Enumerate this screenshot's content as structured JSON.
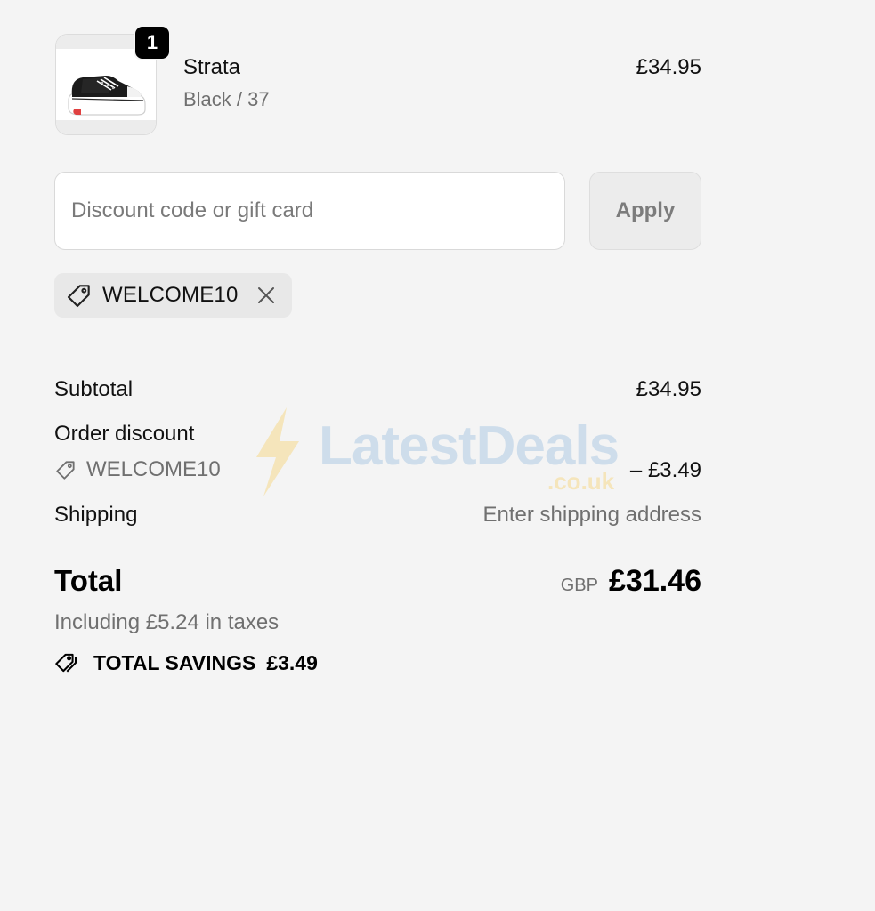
{
  "product": {
    "name": "Strata",
    "variant": "Black / 37",
    "price": "£34.95",
    "quantity": "1",
    "thumbnail_icon": "sneaker-icon"
  },
  "discount": {
    "placeholder": "Discount code or gift card",
    "value": "",
    "apply_label": "Apply",
    "applied_code": "WELCOME10"
  },
  "summary": {
    "subtotal_label": "Subtotal",
    "subtotal_value": "£34.95",
    "order_discount_label": "Order discount",
    "order_discount_code": "WELCOME10",
    "order_discount_value": "– £3.49",
    "shipping_label": "Shipping",
    "shipping_value": "Enter shipping address"
  },
  "total": {
    "label": "Total",
    "currency": "GBP",
    "amount": "£31.46",
    "taxes_note": "Including £5.24 in taxes",
    "savings_label": "TOTAL SAVINGS",
    "savings_value": "£3.49"
  },
  "watermark": {
    "brand": "LatestDeals",
    "domain": ".co.uk"
  },
  "colors": {
    "background": "#f4f4f4",
    "muted_text": "#707070",
    "chip_background": "#e8e8e8",
    "badge": "#000000"
  }
}
